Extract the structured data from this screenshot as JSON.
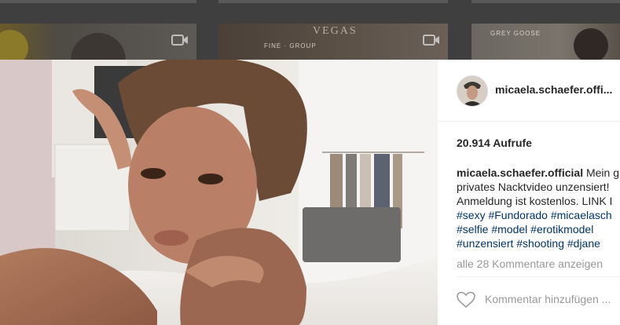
{
  "post": {
    "header_username": "micaela.schaefer.offi...",
    "views": "20.914 Aufrufe",
    "caption_username": "micaela.schaefer.official",
    "caption_lines": [
      "Mein g",
      "privates Nacktvideo unzensiert!",
      "Anmeldung ist kostenlos. LINK I",
      "#sexy #Fundorado #micaelasch",
      "#selfie #model #erotikmodel",
      "#unzensiert #shooting #djane"
    ],
    "view_comments": "alle 28 Kommentare anzeigen",
    "comment_placeholder": "Kommentar hinzufügen ..."
  },
  "background": {
    "thumb_1_text": "FINE · GROUP",
    "thumb_1_text_b": "VEGAS",
    "thumb_2_text": "GREY GOOSE"
  },
  "icons": {
    "video": "video-camera-icon",
    "like": "heart-icon"
  },
  "colors": {
    "hashtag": "#003569",
    "username": "#262626",
    "muted": "#999999",
    "overlay": "#3f3f3f"
  }
}
